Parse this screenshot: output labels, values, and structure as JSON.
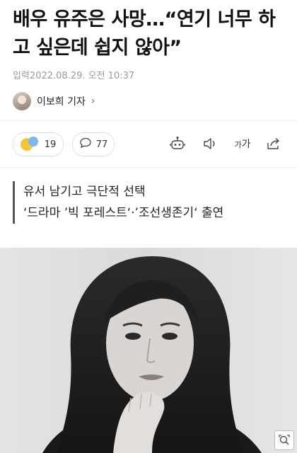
{
  "article": {
    "headline": "배우 유주은 사망…“연기 너무 하고 싶은데 쉽지 않아”",
    "dateline": "입력2022.08.29. 오전 10:37",
    "reporter": "이보희 기자",
    "reporter_chevron": "›"
  },
  "toolbar": {
    "reaction_count": "19",
    "comment_count": "77",
    "font_size_label_small": "가",
    "font_size_label_large": "가",
    "icons": [
      "reaction-emoji-icon",
      "comment-icon",
      "robot-summary-icon",
      "speaker-icon",
      "font-size-icon",
      "share-icon"
    ]
  },
  "subheadings": [
    "유서 남기고 극단적 선택",
    "‘드라마 ’빅 포레스트‘·’조선생존기‘ 출연"
  ],
  "photo": {
    "description_icon": "expand-icon"
  }
}
